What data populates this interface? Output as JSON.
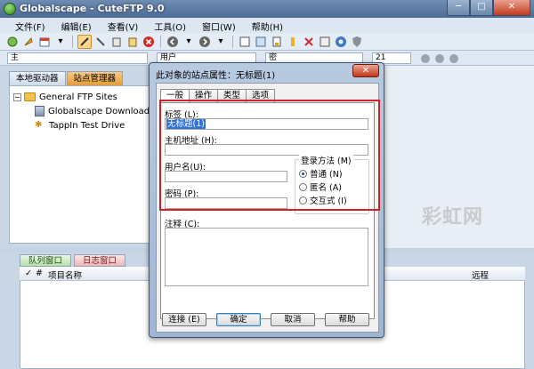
{
  "app": {
    "title": "Globalscape - CuteFTP 9.0"
  },
  "window_controls": {
    "minimize": "─",
    "maximize": "□",
    "close": "✕"
  },
  "menu": [
    "文件(F)",
    "编辑(E)",
    "查看(V)",
    "工具(O)",
    "窗口(W)",
    "帮助(H)"
  ],
  "toolbar": {
    "icons": [
      "connect-icon",
      "quick-connect-icon",
      "site-manager-icon",
      "disconnect-icon",
      "reconnect-icon",
      "download-icon",
      "upload-icon",
      "stop-icon",
      "back-icon",
      "forward-icon",
      "refresh-icon",
      "sites-icon",
      "filter-icon",
      "delete-icon",
      "help-icon",
      "shield-icon"
    ]
  },
  "address_bar": {
    "host_prefix": "主",
    "user_label": "用户",
    "password_label": "密",
    "port_value": "21"
  },
  "left_panel": {
    "tabs": [
      "本地驱动器",
      "站点管理器"
    ],
    "active_tab": 1,
    "tree": {
      "root": "General FTP Sites",
      "items": [
        "Globalscape Download Si",
        "TappIn Test Drive"
      ]
    }
  },
  "bottom": {
    "tabs": [
      "队列窗口",
      "日志窗口"
    ],
    "columns": {
      "hash": "#",
      "item": "项目名称",
      "remote": "远程"
    }
  },
  "dialog": {
    "title": "此对象的站点属性：无标题(1)",
    "close_label": "✕",
    "tabs": [
      "一般",
      "操作",
      "类型",
      "选项"
    ],
    "active_tab": 0,
    "label_field": {
      "label": "标签 (L):",
      "value": "无标题(1)"
    },
    "host_field": {
      "label": "主机地址 (H):",
      "value": ""
    },
    "username_field": {
      "label": "用户名(U):",
      "value": ""
    },
    "password_field": {
      "label": "密码 (P):",
      "value": ""
    },
    "login_method": {
      "legend": "登录方法 (M)",
      "options": [
        "普通 (N)",
        "匿名 (A)",
        "交互式 (I)"
      ],
      "selected": 0
    },
    "comment": {
      "label": "注释 (C):",
      "value": ""
    },
    "buttons": [
      "连接 (E)",
      "确定",
      "取消",
      "帮助"
    ],
    "default_button": 1
  },
  "watermark": {
    "text": "彩虹网"
  },
  "colors": {
    "highlight_frame": "#d1222a",
    "selection": "#3174d6",
    "title_bar": "#4d6c95"
  }
}
